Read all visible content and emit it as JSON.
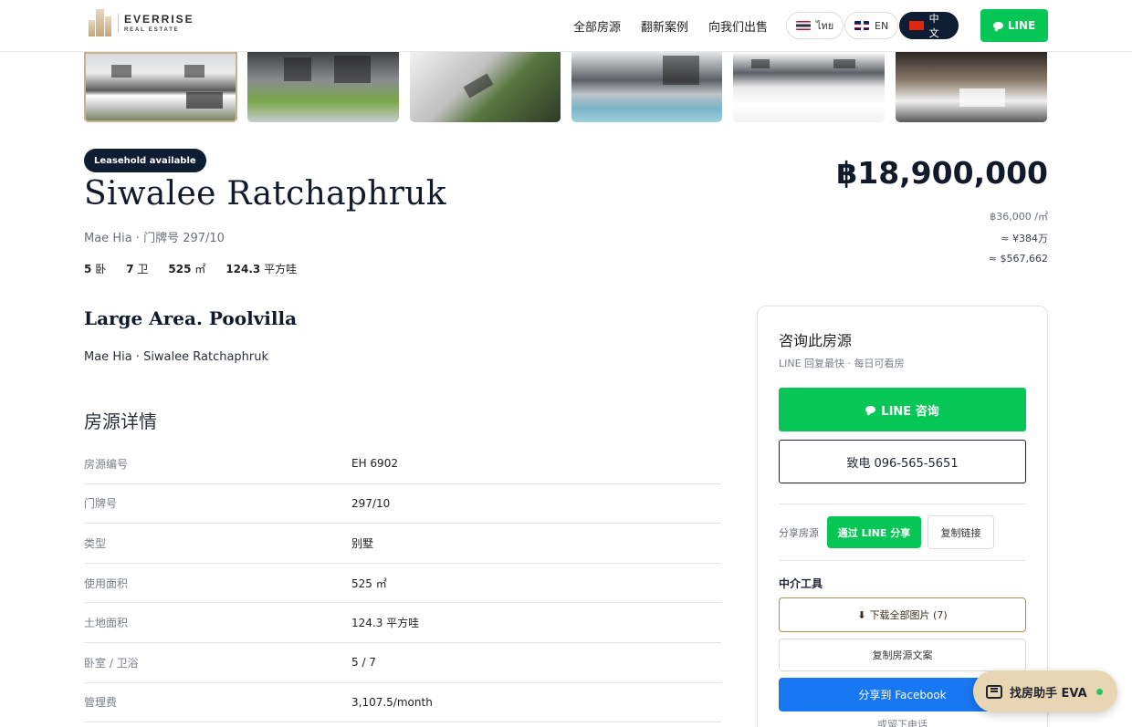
{
  "header": {
    "brand": "EVERRISE",
    "brand_sub": "REAL ESTATE",
    "nav": [
      "全部房源",
      "翻新案例",
      "向我们出售"
    ],
    "languages": [
      {
        "label": "ไทย",
        "active": false
      },
      {
        "label": "EN",
        "active": false
      },
      {
        "label": "中文",
        "active": true
      }
    ],
    "line_label": "LINE"
  },
  "gallery": {
    "count": 6
  },
  "listing": {
    "badge": "Leasehold available",
    "title": "Siwalee Ratchaphruk",
    "address": "Mae Hia · 门牌号 297/10",
    "specs": {
      "bed_num": "5",
      "bed_unit": "卧",
      "bath_num": "7",
      "bath_unit": "卫",
      "area_num": "525",
      "area_unit": "㎡",
      "land_num": "124.3",
      "land_unit": "平方哇"
    },
    "price": "฿18,900,000",
    "price_per_sqm": "฿36,000 /㎡",
    "price_cny": "≈ ¥384万",
    "price_usd": "≈ $567,662",
    "headline": "Large Area. Poolvilla",
    "subline": "Mae Hia · Siwalee Ratchaphruk"
  },
  "details": {
    "title": "房源详情",
    "rows": [
      {
        "k": "房源编号",
        "v": "EH 6902"
      },
      {
        "k": "门牌号",
        "v": "297/10"
      },
      {
        "k": "类型",
        "v": "别墅"
      },
      {
        "k": "使用面积",
        "v": "525 ㎡"
      },
      {
        "k": "土地面积",
        "v": "124.3 平方哇"
      },
      {
        "k": "卧室 / 卫浴",
        "v": "5 / 7"
      },
      {
        "k": "管理费",
        "v": "3,107.5/month"
      }
    ]
  },
  "inquiry": {
    "title": "咨询此房源",
    "sub": "LINE 回复最快 · 每日可看房",
    "line_btn": "LINE 咨询",
    "call_btn": "致电 096-565-5651",
    "share_label": "分享房源",
    "share_line": "通过 LINE 分享",
    "copy_link": "复制链接",
    "tools_label": "中介工具",
    "download": "下载全部图片 (7)",
    "copy_text": "复制房源文案",
    "facebook": "分享到 Facebook",
    "leave_phone": "或留下电话"
  },
  "assistant": {
    "label": "找房助手 EVA"
  },
  "colors": {
    "line_green": "#06c755",
    "navy": "#0f1d33",
    "facebook_blue": "#1877f2",
    "gold": "#b08d5a"
  }
}
